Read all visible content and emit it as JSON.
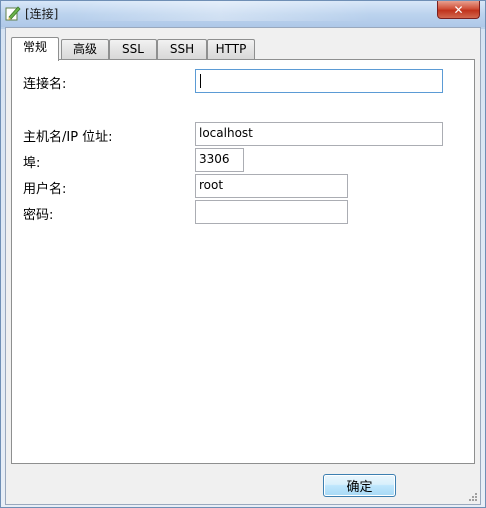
{
  "window": {
    "title": "[连接]",
    "close_label": "✕"
  },
  "tabs": [
    {
      "label": "常规"
    },
    {
      "label": "高级"
    },
    {
      "label": "SSL"
    },
    {
      "label": "SSH"
    },
    {
      "label": "HTTP"
    }
  ],
  "form": {
    "connection_name_label": "连接名:",
    "connection_name_value": "",
    "host_label": "主机名/IP 位址:",
    "host_value": "localhost",
    "port_label": "埠:",
    "port_value": "3306",
    "username_label": "用户名:",
    "username_value": "root",
    "password_label": "密码:",
    "password_value": ""
  },
  "buttons": {
    "ok_label": "确定"
  }
}
